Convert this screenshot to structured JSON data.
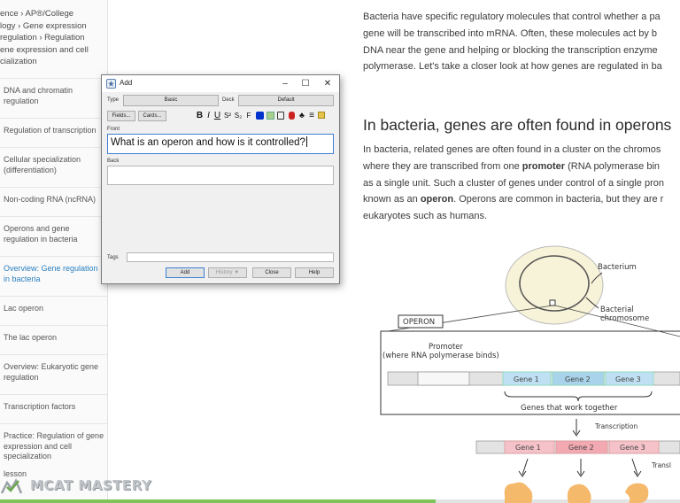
{
  "breadcrumb": {
    "lines": [
      "ence › AP®︎/College",
      "logy › Gene expression",
      "regulation › Regulation",
      "ene expression and cell",
      "cialization"
    ]
  },
  "sidebar": {
    "items": [
      {
        "label": "DNA and chromatin regulation"
      },
      {
        "label": "Regulation of transcription"
      },
      {
        "label": "Cellular specialization (differentiation)"
      },
      {
        "label": "Non-coding RNA (ncRNA)"
      },
      {
        "label": "Operons and gene regulation in bacteria"
      },
      {
        "label": "Overview: Gene regulation in bacteria"
      },
      {
        "label": "Lac operon"
      },
      {
        "label": "The lac operon"
      },
      {
        "label": "Overview: Eukaryotic gene regulation"
      },
      {
        "label": "Transcription factors"
      },
      {
        "label": "Practice: Regulation of gene expression and cell specialization"
      }
    ],
    "lesson_label": "lesson",
    "progress": 0.64
  },
  "watermark": {
    "text": "MCAT MASTERY"
  },
  "article": {
    "intro_lines": [
      "Bacteria have specific regulatory molecules that control whether a pa",
      "gene will be transcribed into mRNA. Often, these molecules act by b",
      "DNA near the gene and helping or blocking the transcription enzyme",
      "polymerase. Let's take a closer look at how genes are regulated in ba"
    ],
    "heading": "In bacteria, genes are often found in operons",
    "body": {
      "l1": "In bacteria, related genes are often found in a cluster on the chromos",
      "l2_pre": "where they are transcribed from one ",
      "l2_bold": "promoter",
      "l2_post": " (RNA polymerase bin",
      "l3": "as a single unit. Such a cluster of genes under control of a single pron",
      "l4_pre": "known as an ",
      "l4_bold": "operon",
      "l4_post": ". Operons are common in bacteria, but they are r",
      "l5": "eukaryotes such as humans."
    }
  },
  "diagram": {
    "bacterium": "Bacterium",
    "chromosome_1": "Bacterial",
    "chromosome_2": "chromosome",
    "operon": "OPERON",
    "promoter_1": "Promoter",
    "promoter_2": "(where RNA polymerase binds)",
    "genes": [
      "Gene 1",
      "Gene 2",
      "Gene 3"
    ],
    "together": "Genes that work together",
    "transcription": "Transcription",
    "translation": "Transl"
  },
  "dialog": {
    "title": "Add",
    "type_label": "Type",
    "type_value": "Basic",
    "deck_label": "Deck",
    "deck_value": "Default",
    "fields_btn": "Fields...",
    "cards_btn": "Cards...",
    "front_label": "Front",
    "front_value": "What is an operon and how is it controlled?",
    "back_label": "Back",
    "back_value": "",
    "tags_label": "Tags",
    "tags_value": "",
    "add_btn": "Add",
    "history_btn": "History ▼",
    "close_btn": "Close",
    "help_btn": "Help"
  },
  "colors": {
    "link": "#2a7fc0",
    "gene_blue": "#bfe0f2",
    "gene_pink": "#f2a9b2",
    "progress_green": "#7fc45a"
  }
}
